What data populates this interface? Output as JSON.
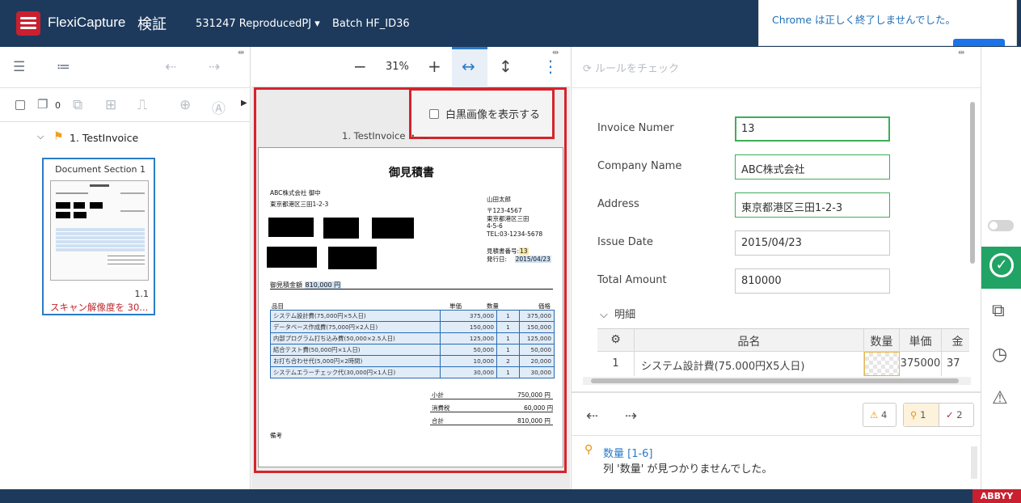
{
  "header": {
    "app_name": "FlexiCapture",
    "mode": "検証",
    "project": "531247 ReproducedPJ",
    "project_caret": "▾",
    "batch": "Batch HF_ID36"
  },
  "notification": {
    "text": "Chrome は正しく終了しませんでした。"
  },
  "left_panel": {
    "page_count": "0",
    "tree_item": "1. TestInvoice",
    "thumbnail": {
      "title": "Document Section 1",
      "page_number": "1.1",
      "warning": "スキャン解像度を 30..."
    }
  },
  "viewer": {
    "zoom": "31%",
    "zoom_out": "−",
    "zoom_in": "+",
    "fit_width": "↔",
    "fit_height": "↕",
    "more": "⋮",
    "bw_option": "白黒画像を表示する",
    "doc_label": "1. TestInvoice ・ ..."
  },
  "document": {
    "title": "御見積書",
    "to_company": "ABC株式会社 御中",
    "to_address": "東京都港区三田1-2-3",
    "from_name": "山田太郎",
    "from_zip": "〒123-4567",
    "from_addr1": "東京都港区三田",
    "from_addr2": "4-5-6",
    "from_tel": "TEL:03-1234-5678",
    "quote_no_label": "見積書番号:",
    "quote_no": "13",
    "issue_label": "発行日:",
    "issue_date": "2015/04/23",
    "total_label": "御見積金額",
    "total_value": "810,000 円",
    "col_item": "品目",
    "col_unit": "単価",
    "col_qty": "数量",
    "col_price": "価格",
    "lines": [
      {
        "item": "システム設計費(75,000円×5人日)",
        "unit": "375,000",
        "qty": "1",
        "price": "375,000"
      },
      {
        "item": "データベース作成費(75,000円×2人日)",
        "unit": "150,000",
        "qty": "1",
        "price": "150,000"
      },
      {
        "item": "内部プログラム打ち込み費(50,000×2.5人日)",
        "unit": "125,000",
        "qty": "1",
        "price": "125,000"
      },
      {
        "item": "結合テスト費(50,000円×1人日)",
        "unit": "50,000",
        "qty": "1",
        "price": "50,000"
      },
      {
        "item": "お打ち合わせ代(5,000円×2時間)",
        "unit": "10,000",
        "qty": "2",
        "price": "20,000"
      },
      {
        "item": "システムエラーチェック代(30,000円×1人日)",
        "unit": "30,000",
        "qty": "1",
        "price": "30,000"
      }
    ],
    "subtotal_label": "小計",
    "subtotal": "750,000 円",
    "tax_label": "消費税",
    "tax": "60,000 円",
    "grand_label": "合計",
    "grand": "810,000 円",
    "remarks_label": "備考"
  },
  "form": {
    "rules_check": "ルールをチェック",
    "fields": [
      {
        "label": "Invoice Numer",
        "value": "13"
      },
      {
        "label": "Company Name",
        "value": "ABC株式会社"
      },
      {
        "label": "Address",
        "value": "東京都港区三田1-2-3"
      },
      {
        "label": "Issue Date",
        "value": "2015/04/23"
      },
      {
        "label": "Total Amount",
        "value": "810000"
      }
    ],
    "section": "明細",
    "grid_headers": [
      "品名",
      "数量",
      "単価",
      "金"
    ],
    "grid_row": {
      "index": "1",
      "name": "システム設計費(75.000円X5人日)",
      "qty": "",
      "unit": "375000",
      "amount": "37"
    }
  },
  "issues": {
    "warning_count": "4",
    "question_count": "1",
    "check_count": "2",
    "message_title": "数量 [1-6]",
    "message_body": "列 '数量' が見つかりませんでした。"
  },
  "footer": {
    "brand": "ABBYY"
  }
}
